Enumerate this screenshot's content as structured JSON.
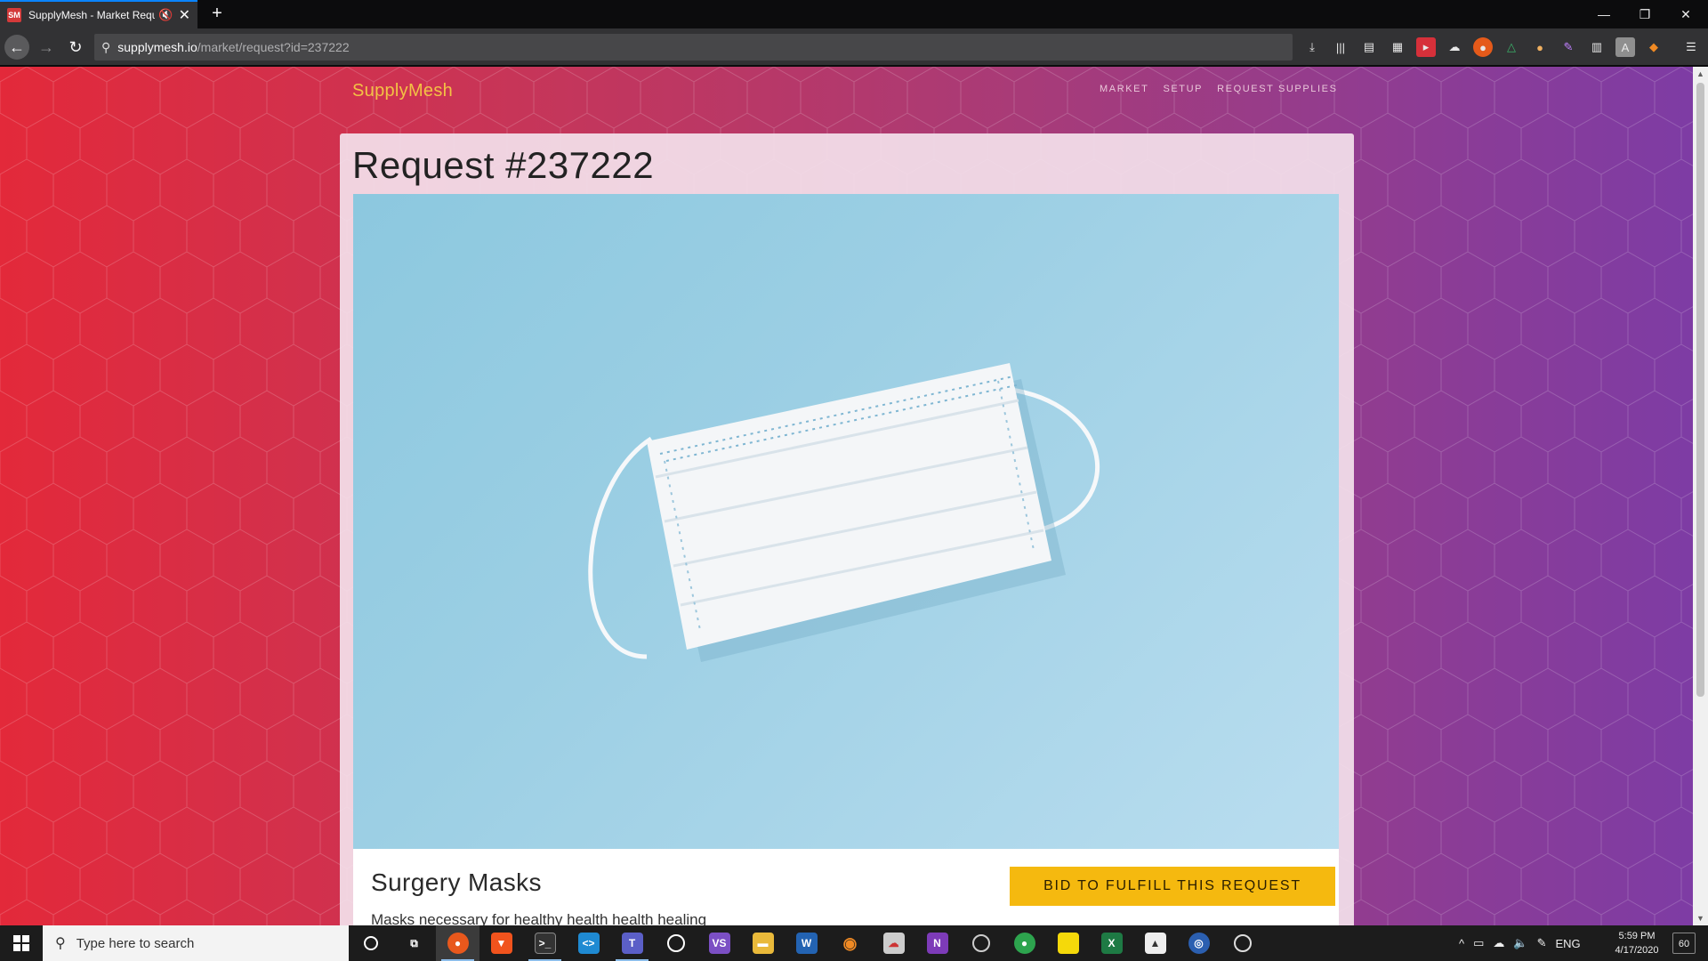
{
  "browser": {
    "tab": {
      "title": "SupplyMesh - Market Requ",
      "favicon_text": "SM"
    },
    "new_tab": "+",
    "window_controls": {
      "minimize": "—",
      "restore": "❐",
      "close": "✕"
    },
    "url": {
      "host": "supplymesh.io",
      "path": "/market/request?id=237222"
    }
  },
  "site": {
    "brand": "SupplyMesh",
    "nav": [
      "MARKET",
      "SETUP",
      "REQUEST SUPPLIES"
    ]
  },
  "request": {
    "title": "Request #237222",
    "item_name": "Surgery Masks",
    "description": "Masks necessary for healthy health health healing",
    "bid_button": "BID TO FULFILL THIS REQUEST"
  },
  "taskbar": {
    "search_placeholder": "Type here to search",
    "tray_lang": "ENG",
    "time": "5:59 PM",
    "date": "4/17/2020",
    "notifications": "60"
  },
  "colors": {
    "brand": "#f3c244",
    "bid_button": "#f5b90f",
    "gradient_left": "#e3293a",
    "gradient_right": "#7d3ca5"
  }
}
